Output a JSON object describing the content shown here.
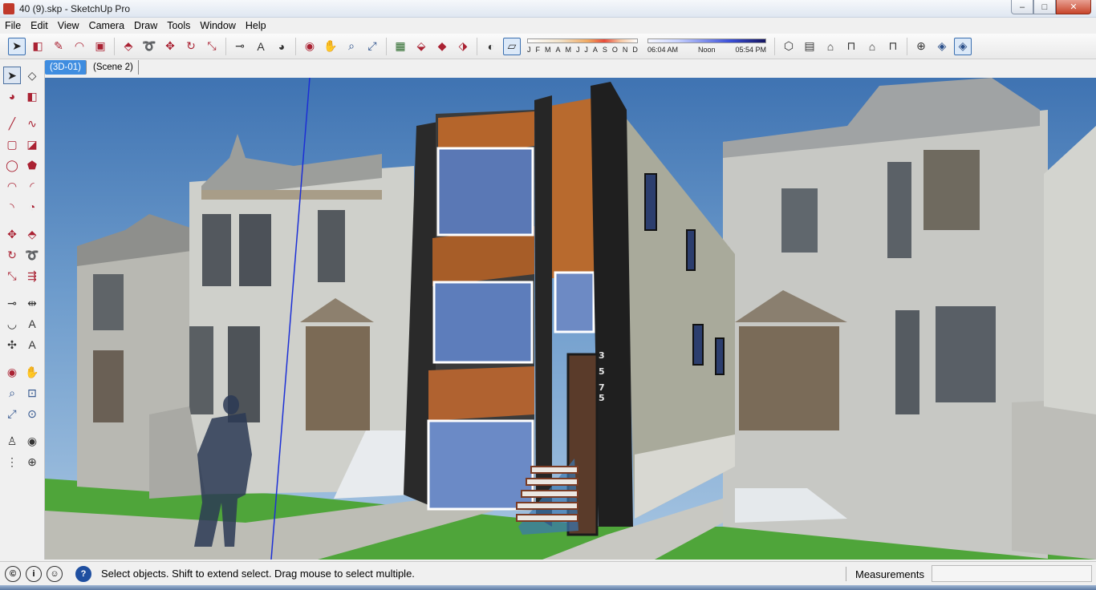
{
  "window": {
    "title": "40 (9).skp - SketchUp Pro",
    "controls": {
      "minimize": "–",
      "maximize": "□",
      "close": "✕"
    }
  },
  "menu": [
    "File",
    "Edit",
    "View",
    "Camera",
    "Draw",
    "Tools",
    "Window",
    "Help"
  ],
  "toolbar": {
    "shadow_months": [
      "J",
      "F",
      "M",
      "A",
      "M",
      "J",
      "J",
      "A",
      "S",
      "O",
      "N",
      "D"
    ],
    "shadow_time": {
      "start": "06:04 AM",
      "mid": "Noon",
      "end": "05:54 PM"
    }
  },
  "scene_tabs": [
    {
      "label": "(3D-01)",
      "active": true
    },
    {
      "label": "(Scene 2)",
      "active": false
    }
  ],
  "viewport": {
    "house_number": [
      "3",
      "5",
      "7",
      "5"
    ],
    "colors": {
      "sky_top": "#3f73b2",
      "grass": "#4fa53a",
      "dark_facade": "#2a2a2a",
      "wood": "#b5652b",
      "siding": "#c9c9c3"
    }
  },
  "status": {
    "message": "Select objects. Shift to extend select. Drag mouse to select multiple.",
    "measurements_label": "Measurements",
    "measurements_value": ""
  }
}
